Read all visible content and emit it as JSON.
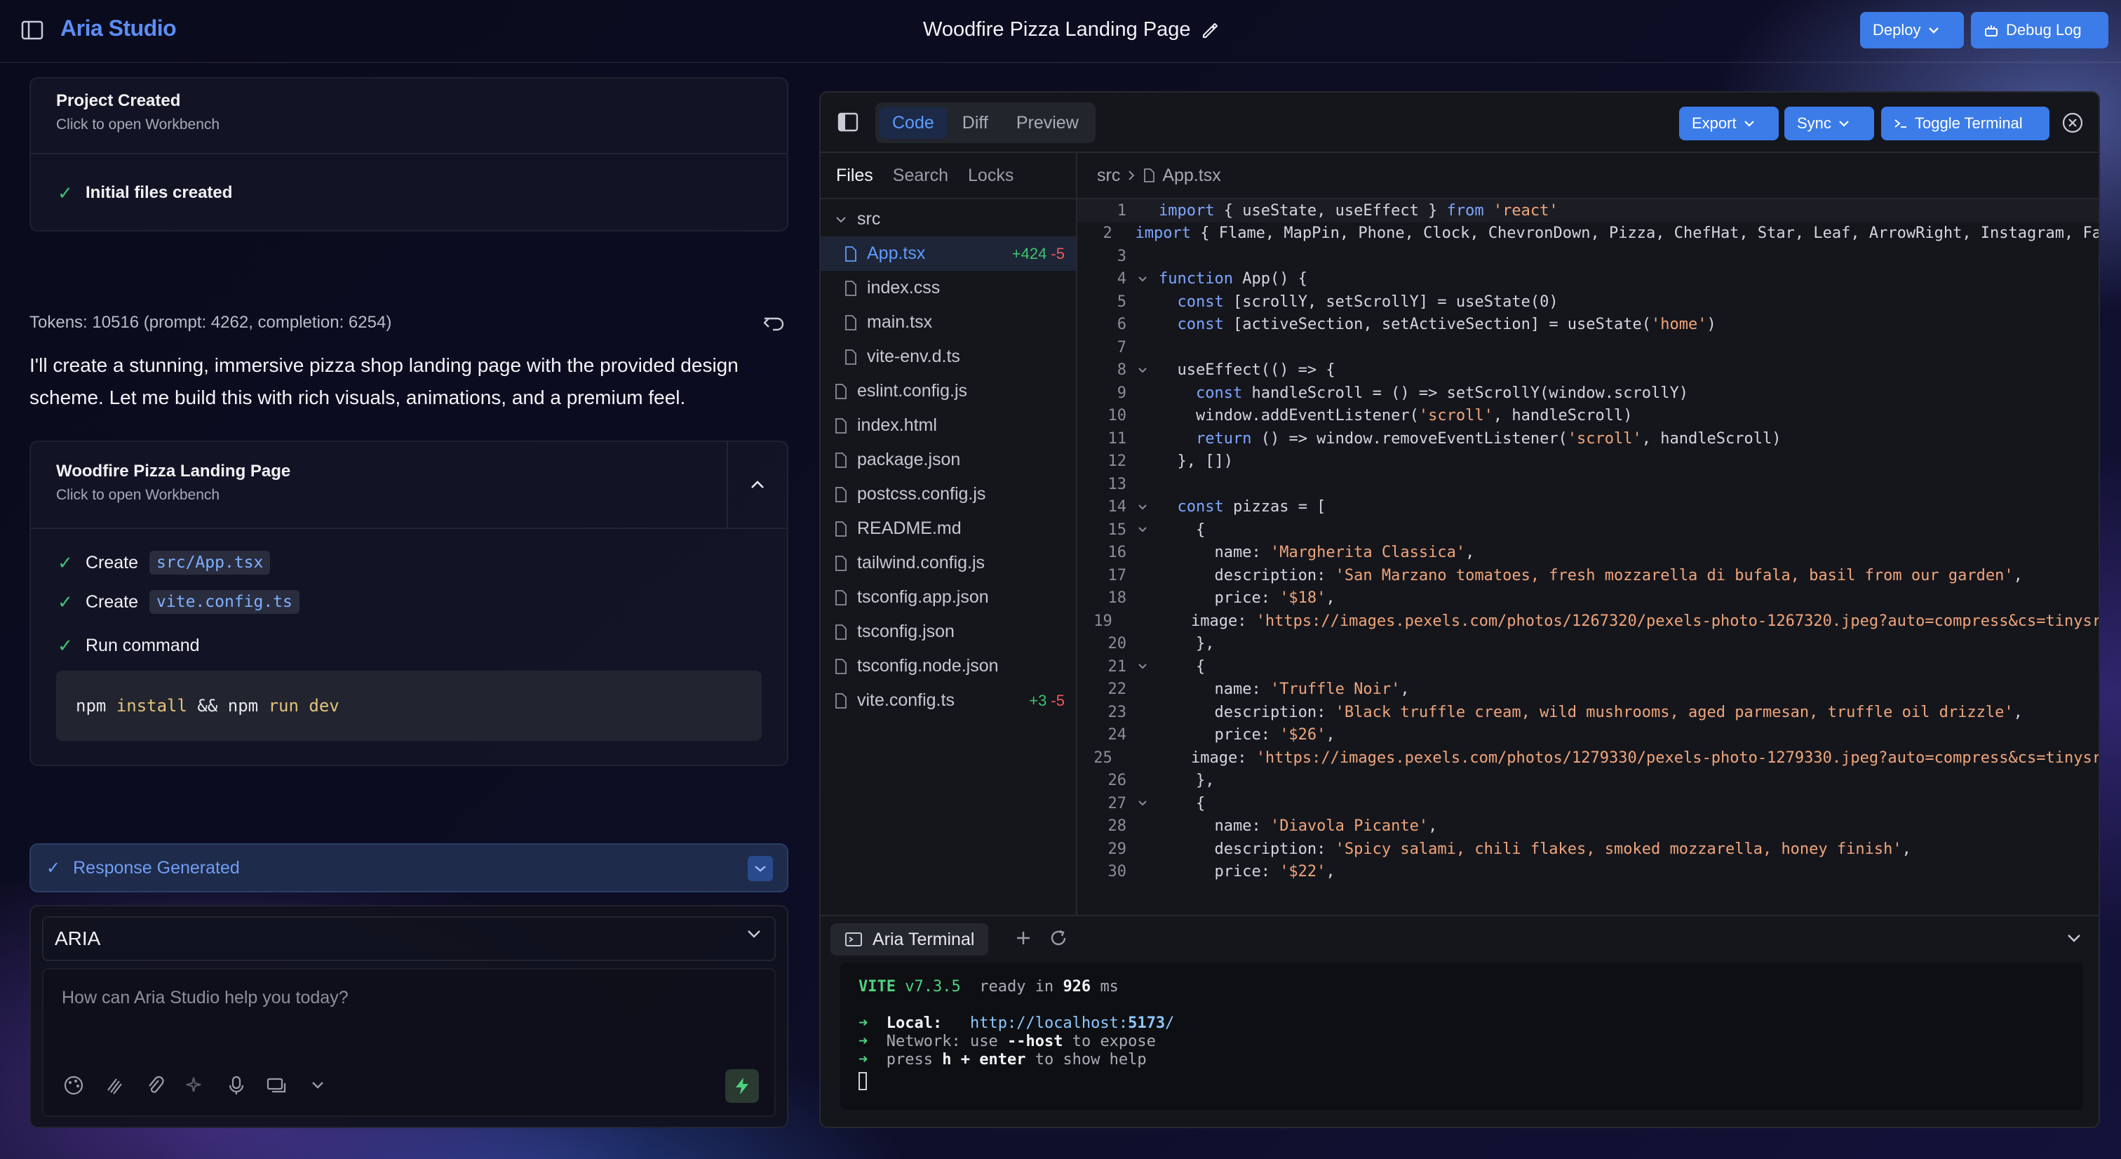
{
  "header": {
    "brand": "Aria Studio",
    "title": "Woodfire Pizza Landing Page",
    "deploy_label": "Deploy",
    "debug_label": "Debug Log"
  },
  "chat": {
    "project_card": {
      "title": "Project Created",
      "subtitle": "Click to open Workbench",
      "step": "Initial files created"
    },
    "tokens": "Tokens: 10516 (prompt: 4262, completion: 6254)",
    "message": "I'll create a stunning, immersive pizza shop landing page with the provided design scheme. Let me build this with rich visuals, animations, and a premium feel.",
    "artifact": {
      "title": "Woodfire Pizza Landing Page",
      "subtitle": "Click to open Workbench",
      "actions": [
        {
          "verb": "Create",
          "target": "src/App.tsx"
        },
        {
          "verb": "Create",
          "target": "vite.config.ts"
        }
      ],
      "run_label": "Run command",
      "command": {
        "p1": "npm",
        "w1": "install",
        "amp": "&&",
        "p2": "npm",
        "w2": "run dev"
      }
    },
    "response_status": "Response Generated",
    "model": "ARIA",
    "placeholder": "How can Aria Studio help you today?"
  },
  "workbench": {
    "tabs": [
      "Code",
      "Diff",
      "Preview"
    ],
    "active_tab": "Code",
    "export_label": "Export",
    "sync_label": "Sync",
    "toggle_terminal_label": "Toggle Terminal",
    "file_tabs": [
      "Files",
      "Search",
      "Locks"
    ],
    "files": [
      {
        "name": "src",
        "type": "folder",
        "depth": 0
      },
      {
        "name": "App.tsx",
        "type": "file",
        "depth": 1,
        "selected": true,
        "added": "+424",
        "removed": "-5"
      },
      {
        "name": "index.css",
        "type": "file",
        "depth": 1
      },
      {
        "name": "main.tsx",
        "type": "file",
        "depth": 1
      },
      {
        "name": "vite-env.d.ts",
        "type": "file",
        "depth": 1
      },
      {
        "name": "eslint.config.js",
        "type": "file",
        "depth": 0
      },
      {
        "name": "index.html",
        "type": "file",
        "depth": 0
      },
      {
        "name": "package.json",
        "type": "file",
        "depth": 0
      },
      {
        "name": "postcss.config.js",
        "type": "file",
        "depth": 0
      },
      {
        "name": "README.md",
        "type": "file",
        "depth": 0
      },
      {
        "name": "tailwind.config.js",
        "type": "file",
        "depth": 0
      },
      {
        "name": "tsconfig.app.json",
        "type": "file",
        "depth": 0
      },
      {
        "name": "tsconfig.json",
        "type": "file",
        "depth": 0
      },
      {
        "name": "tsconfig.node.json",
        "type": "file",
        "depth": 0
      },
      {
        "name": "vite.config.ts",
        "type": "file",
        "depth": 0,
        "added": "+3",
        "removed": "-5"
      }
    ],
    "breadcrumb": [
      "src",
      "App.tsx"
    ],
    "code_lines": [
      "import { useState, useEffect } from 'react'",
      "import { Flame, MapPin, Phone, Clock, ChevronDown, Pizza, ChefHat, Star, Leaf, ArrowRight, Instagram, Fa",
      "",
      "function App() {",
      "  const [scrollY, setScrollY] = useState(0)",
      "  const [activeSection, setActiveSection] = useState('home')",
      "",
      "  useEffect(() => {",
      "    const handleScroll = () => setScrollY(window.scrollY)",
      "    window.addEventListener('scroll', handleScroll)",
      "    return () => window.removeEventListener('scroll', handleScroll)",
      "  }, [])",
      "",
      "  const pizzas = [",
      "    {",
      "      name: 'Margherita Classica',",
      "      description: 'San Marzano tomatoes, fresh mozzarella di bufala, basil from our garden',",
      "      price: '$18',",
      "      image: 'https://images.pexels.com/photos/1267320/pexels-photo-1267320.jpeg?auto=compress&cs=tinysr",
      "    },",
      "    {",
      "      name: 'Truffle Noir',",
      "      description: 'Black truffle cream, wild mushrooms, aged parmesan, truffle oil drizzle',",
      "      price: '$26',",
      "      image: 'https://images.pexels.com/photos/1279330/pexels-photo-1279330.jpeg?auto=compress&cs=tinysr",
      "    },",
      "    {",
      "      name: 'Diavola Picante',",
      "      description: 'Spicy salami, chili flakes, smoked mozzarella, honey finish',",
      "      price: '$22',"
    ],
    "fold_lines": [
      4,
      8,
      14,
      15,
      21,
      27
    ],
    "terminal": {
      "tab_label": "Aria Terminal",
      "vite": "VITE",
      "version": "v7.3.5",
      "ready": "ready in",
      "ms_value": "926",
      "ms_unit": "ms",
      "local_label": "Local:",
      "local_url_a": "http://localhost:",
      "local_port": "5173",
      "local_url_b": "/",
      "network_label": "Network:",
      "network_a": "use",
      "network_flag": "--host",
      "network_b": "to expose",
      "help_a": "press",
      "help_key": "h + enter",
      "help_b": "to show help"
    }
  }
}
